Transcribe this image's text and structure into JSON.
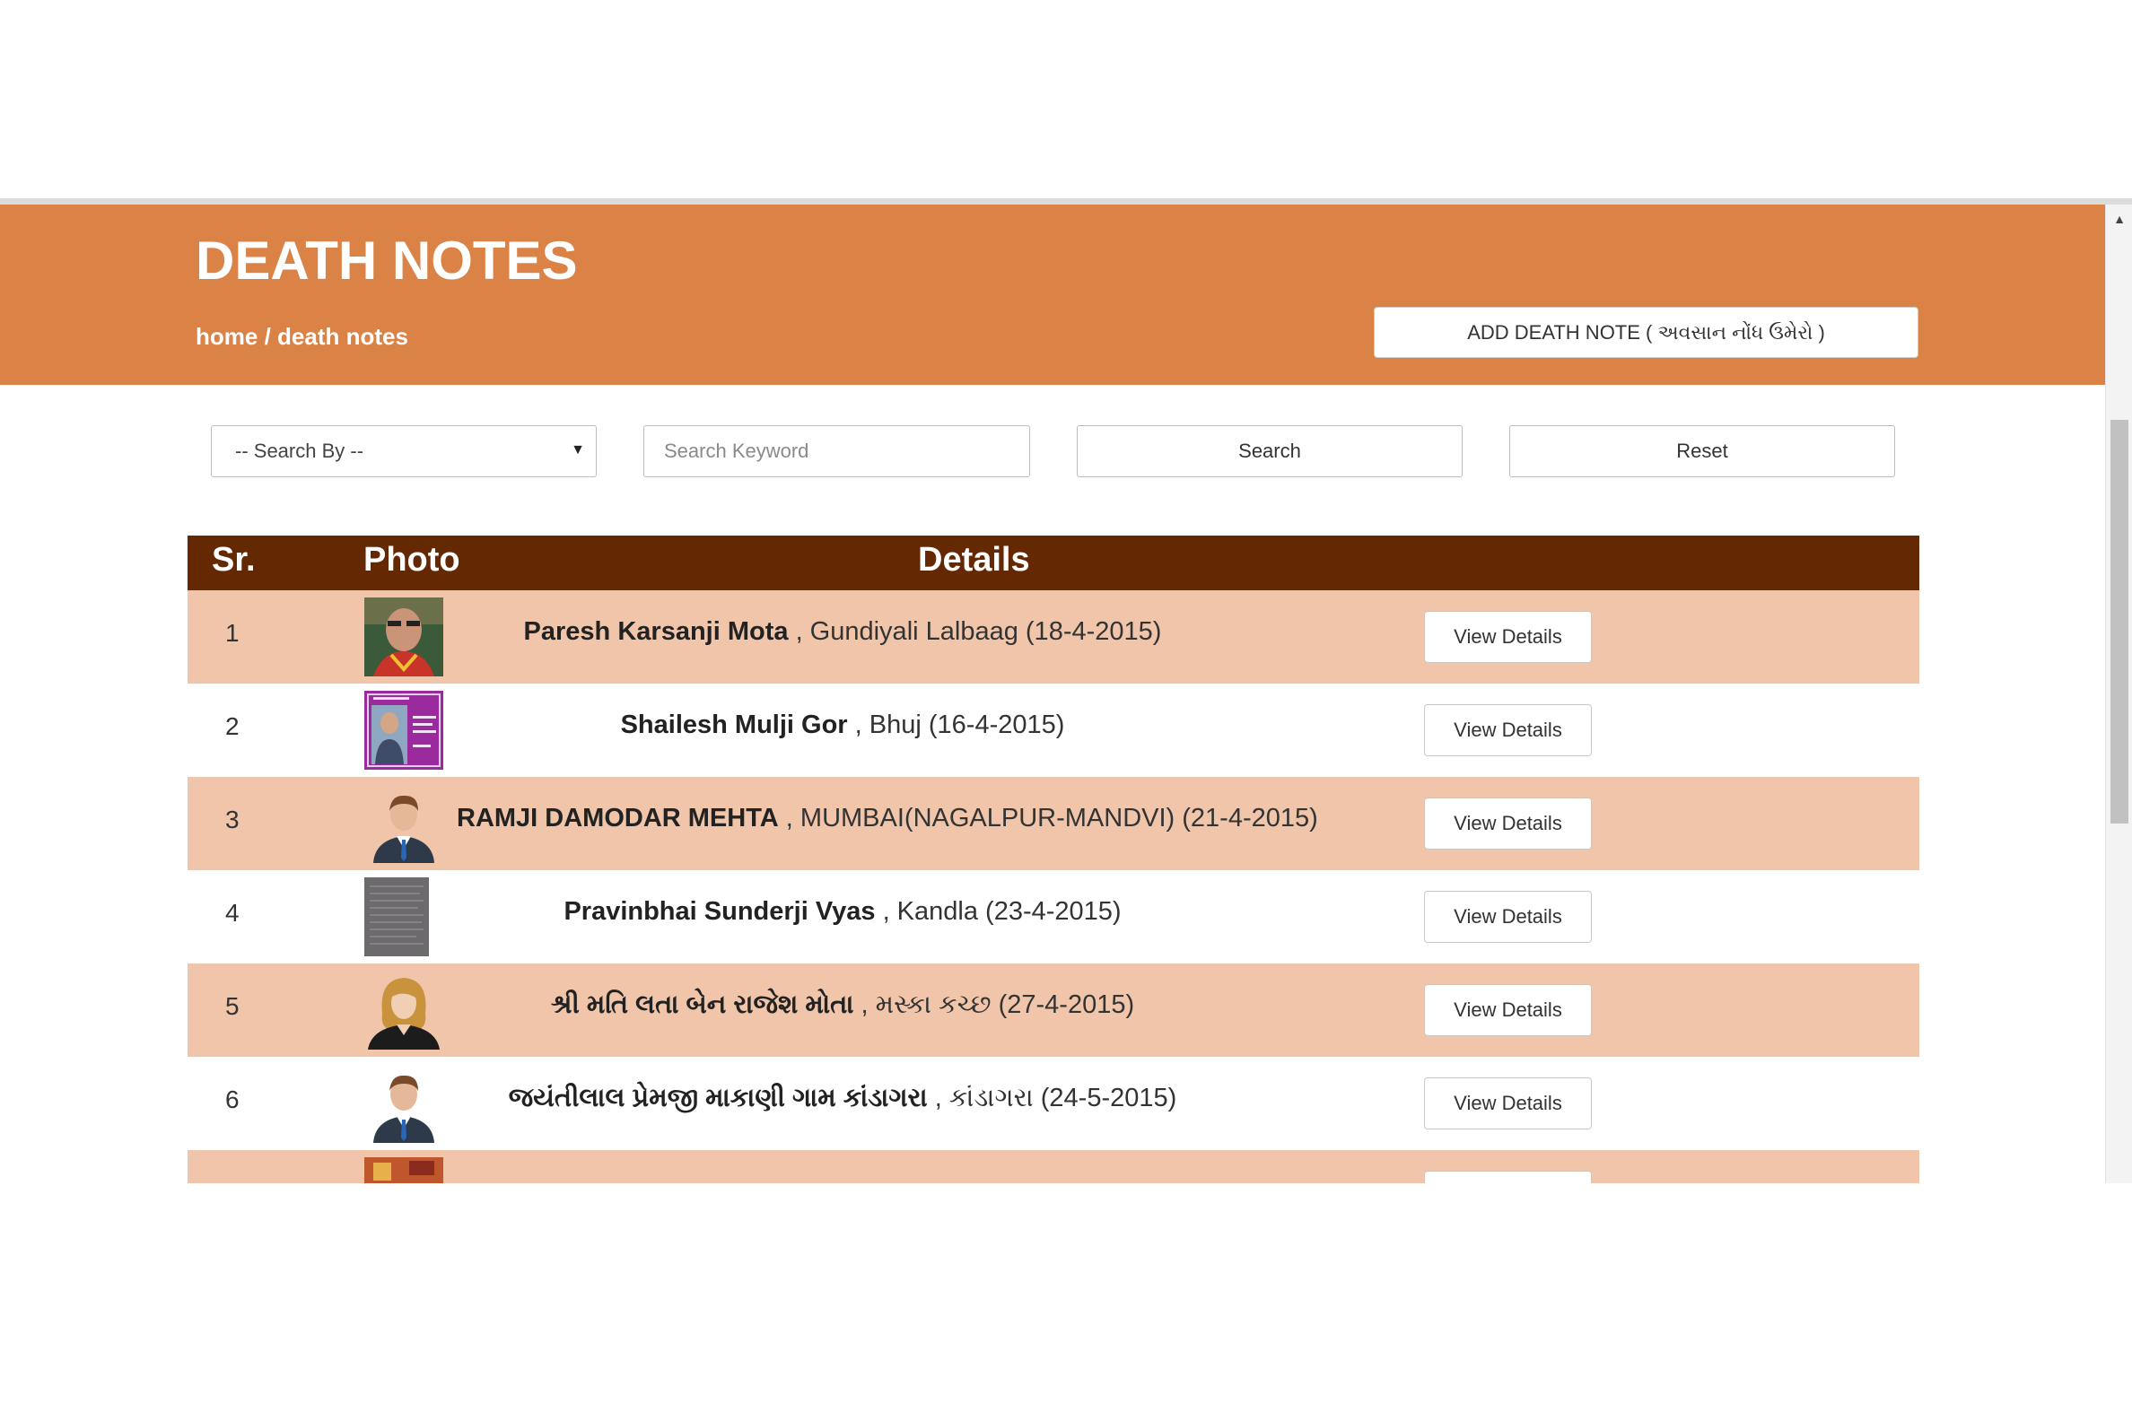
{
  "header": {
    "title": "DEATH NOTES",
    "breadcrumb_home": "home",
    "breadcrumb_sep": " / ",
    "breadcrumb_current": "death notes",
    "add_button": "ADD DEATH NOTE ( અવસાન નોંધ ઉમેરો )",
    "background_color": "#db8347"
  },
  "search": {
    "select_value": "-- Search By --",
    "keyword_placeholder": "Search Keyword",
    "search_button": "Search",
    "reset_button": "Reset"
  },
  "table": {
    "header_color": "#642802",
    "alt_row_color": "#f0c5aa",
    "columns": [
      "Sr.",
      "Photo",
      "Details"
    ],
    "view_label": "View Details",
    "rows": [
      {
        "sr": "1",
        "name": "Paresh Karsanji Mota",
        "place_date": ", Gundiyali Lalbaag (18-4-2015)",
        "photo": "portrait-photo"
      },
      {
        "sr": "2",
        "name": "Shailesh Mulji Gor",
        "place_date": ", Bhuj (16-4-2015)",
        "photo": "poster-photo"
      },
      {
        "sr": "3",
        "name": "RAMJI DAMODAR MEHTA",
        "place_date": ", MUMBAI(NAGALPUR-MANDVI) (21-4-2015)",
        "photo": "male-avatar-icon"
      },
      {
        "sr": "4",
        "name": "Pravinbhai Sunderji Vyas",
        "place_date": ", Kandla (23-4-2015)",
        "photo": "document-photo"
      },
      {
        "sr": "5",
        "name": "શ્રી મતિ લતા બેન રાજેશ મોતા",
        "place_date": ", મસ્કા કચ્છ (27-4-2015)",
        "photo": "female-avatar-icon"
      },
      {
        "sr": "6",
        "name": "જયંતીલાલ પ્રેમજી માકાણી ગામ કાંડાગરા",
        "place_date": ", કાંડાગરા (24-5-2015)",
        "photo": "male-avatar-icon"
      }
    ]
  }
}
